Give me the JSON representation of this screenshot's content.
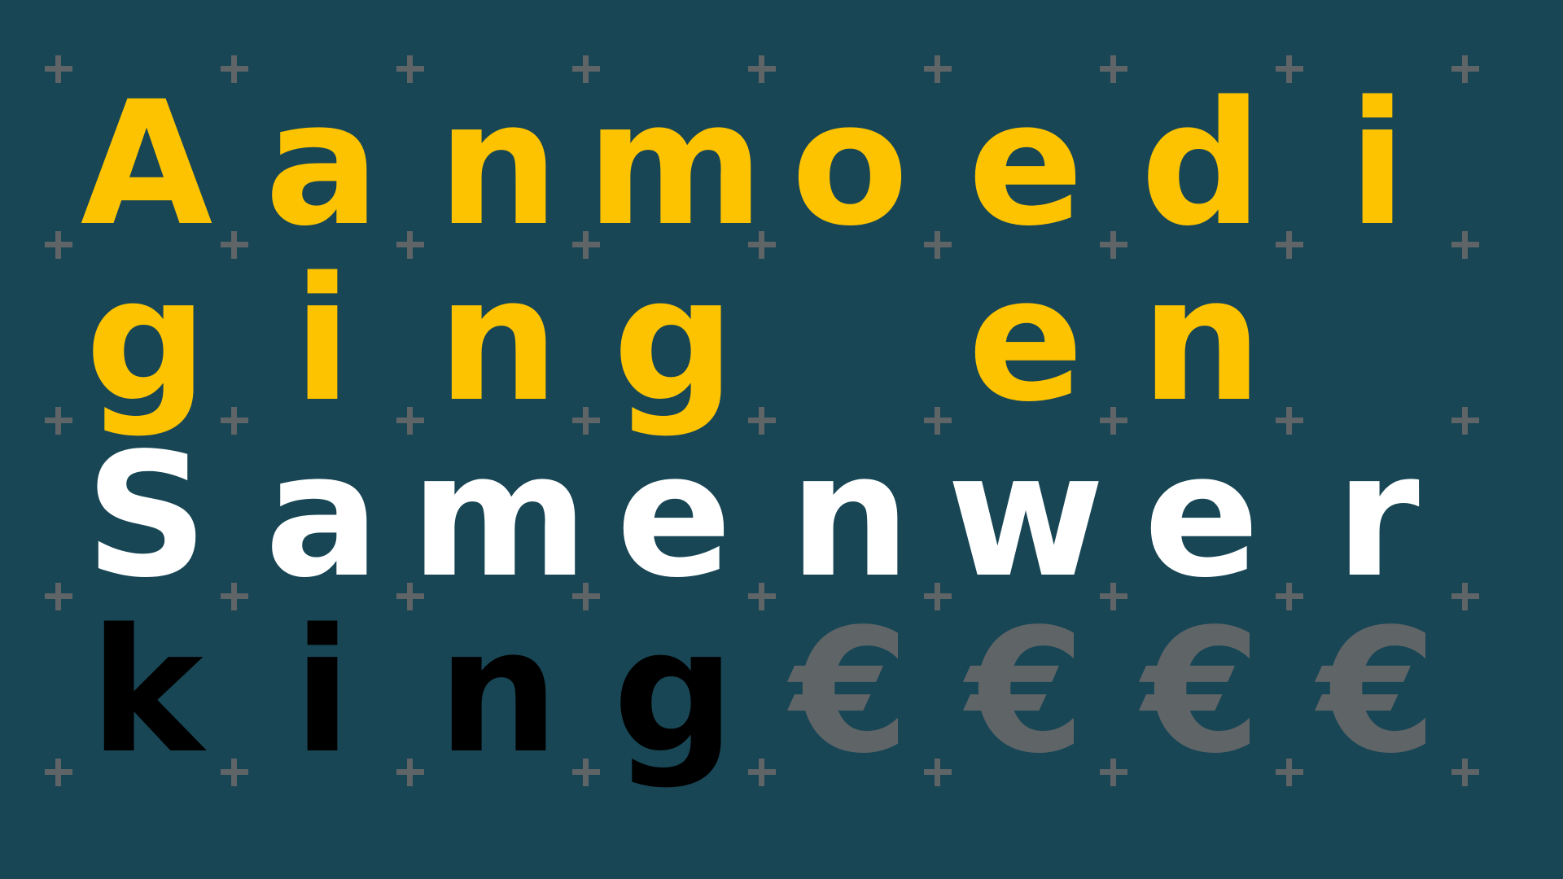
{
  "colors": {
    "background": "#184655",
    "plus_mark": "#5f6467",
    "yellow": "#fdc300",
    "white": "#ffffff",
    "black": "#000000",
    "gray": "#5f6467"
  },
  "rows": [
    {
      "cells": [
        {
          "char": "A",
          "color": "#fdc300"
        },
        {
          "char": "a",
          "color": "#fdc300"
        },
        {
          "char": "n",
          "color": "#fdc300"
        },
        {
          "char": "m",
          "color": "#fdc300"
        },
        {
          "char": "o",
          "color": "#fdc300"
        },
        {
          "char": "e",
          "color": "#fdc300"
        },
        {
          "char": "d",
          "color": "#fdc300"
        },
        {
          "char": "i",
          "color": "#fdc300"
        }
      ]
    },
    {
      "cells": [
        {
          "char": "g",
          "color": "#fdc300"
        },
        {
          "char": "i",
          "color": "#fdc300"
        },
        {
          "char": "n",
          "color": "#fdc300"
        },
        {
          "char": "g",
          "color": "#fdc300"
        },
        {
          "char": "",
          "color": "#fdc300"
        },
        {
          "char": "e",
          "color": "#fdc300"
        },
        {
          "char": "n",
          "color": "#fdc300"
        },
        {
          "char": "",
          "color": "#fdc300"
        }
      ]
    },
    {
      "cells": [
        {
          "char": "S",
          "color": "#ffffff"
        },
        {
          "char": "a",
          "color": "#ffffff"
        },
        {
          "char": "m",
          "color": "#ffffff"
        },
        {
          "char": "e",
          "color": "#ffffff"
        },
        {
          "char": "n",
          "color": "#ffffff"
        },
        {
          "char": "w",
          "color": "#ffffff"
        },
        {
          "char": "e",
          "color": "#ffffff"
        },
        {
          "char": "r",
          "color": "#ffffff"
        }
      ]
    },
    {
      "cells": [
        {
          "char": "k",
          "color": "#000000"
        },
        {
          "char": "i",
          "color": "#000000"
        },
        {
          "char": "n",
          "color": "#000000"
        },
        {
          "char": "g",
          "color": "#000000"
        },
        {
          "char": "€",
          "color": "#5f6467"
        },
        {
          "char": "€",
          "color": "#5f6467"
        },
        {
          "char": "€",
          "color": "#5f6467"
        },
        {
          "char": "€",
          "color": "#5f6467"
        }
      ]
    }
  ]
}
